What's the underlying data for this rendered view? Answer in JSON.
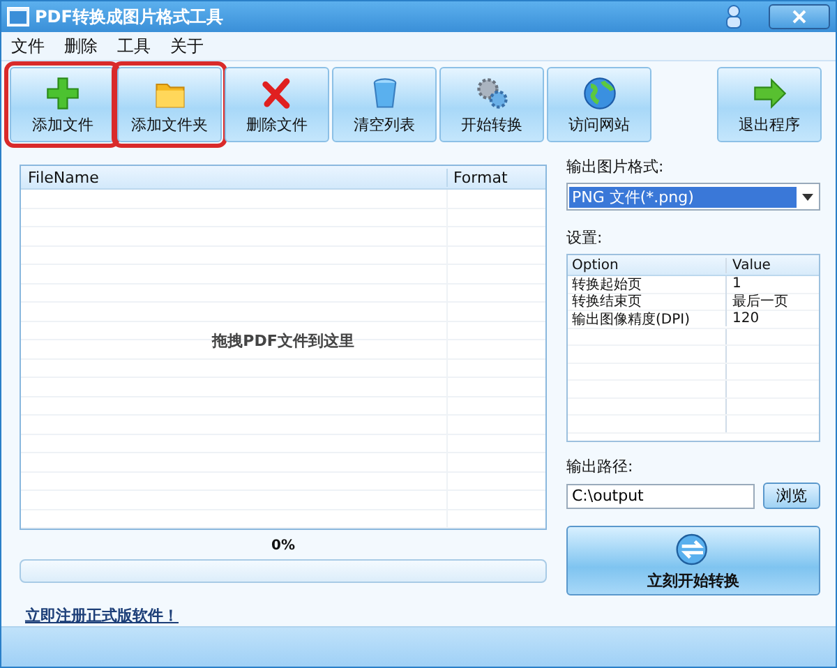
{
  "window": {
    "title": "PDF转换成图片格式工具"
  },
  "menu": [
    "文件",
    "删除",
    "工具",
    "关于"
  ],
  "toolbar": [
    {
      "label": "添加文件",
      "kind": "add",
      "highlighted": true
    },
    {
      "label": "添加文件夹",
      "kind": "folder",
      "highlighted": true
    },
    {
      "label": "删除文件",
      "kind": "delete",
      "highlighted": false
    },
    {
      "label": "清空列表",
      "kind": "clear",
      "highlighted": false
    },
    {
      "label": "开始转换",
      "kind": "start",
      "highlighted": false
    },
    {
      "label": "访问网站",
      "kind": "web",
      "highlighted": false
    }
  ],
  "exit_button": {
    "label": "退出程序"
  },
  "file_list": {
    "columns": [
      "FileName",
      "Format"
    ],
    "empty_hint": "拖拽PDF文件到这里"
  },
  "progress": {
    "reading": "0%",
    "level": 0
  },
  "register_link": "立即注册正式版软件！",
  "output_format": {
    "label": "输出图片格式:",
    "value": "PNG 文件(*.png)"
  },
  "settings": {
    "label": "设置:",
    "columns": [
      "Option",
      "Value"
    ],
    "rows": [
      {
        "option": "转换起始页",
        "value": "1"
      },
      {
        "option": "转换结束页",
        "value": "最后一页"
      },
      {
        "option": "输出图像精度(DPI)",
        "value": "120"
      }
    ]
  },
  "output_path": {
    "label": "输出路径:",
    "value": "C:\\output",
    "browse": "浏览"
  },
  "convert_button": {
    "label": "立刻开始转换"
  }
}
